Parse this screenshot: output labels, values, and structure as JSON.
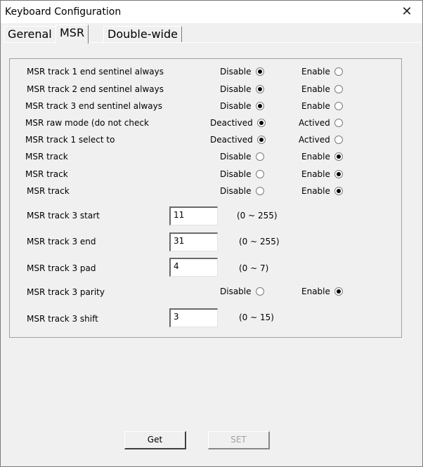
{
  "window": {
    "title": "Keyboard Configuration",
    "close_glyph": "✕"
  },
  "tabs": [
    {
      "label": "Gerenal",
      "active": false
    },
    {
      "label": "MSR",
      "active": true
    },
    {
      "label": "Double-wide",
      "active": false
    }
  ],
  "radio_rows": [
    {
      "label": "MSR track 1 end sentinel always",
      "opt1": "Disable",
      "opt2": "Enable",
      "selected": 1
    },
    {
      "label": "MSR track 2 end sentinel always",
      "opt1": "Disable",
      "opt2": "Enable",
      "selected": 1
    },
    {
      "label": "MSR track 3 end sentinel always",
      "opt1": "Disable",
      "opt2": "Enable",
      "selected": 1
    },
    {
      "label": "MSR raw mode (do not check",
      "opt1": "Deactived",
      "opt2": "Actived",
      "selected": 1
    },
    {
      "label": "MSR track 1 select to",
      "opt1": "Deactived",
      "opt2": "Actived",
      "selected": 1
    },
    {
      "label": "MSR track",
      "opt1": "Disable",
      "opt2": "Enable",
      "selected": 2
    },
    {
      "label": "MSR track",
      "opt1": "Disable",
      "opt2": "Enable",
      "selected": 2
    },
    {
      "label": "MSR track",
      "opt1": "Disable",
      "opt2": "Enable",
      "selected": 2
    }
  ],
  "fields": {
    "start": {
      "label": "MSR track 3 start",
      "value": "11",
      "range": "(0 ~ 255)"
    },
    "end": {
      "label": "MSR track 3 end",
      "value": "31",
      "range": "(0 ~ 255)"
    },
    "pad": {
      "label": "MSR track 3 pad",
      "value": "4",
      "range": "(0 ~ 7)"
    },
    "parity": {
      "label": "MSR track 3 parity",
      "opt1": "Disable",
      "opt2": "Enable",
      "selected": 2
    },
    "shift": {
      "label": "MSR track 3 shift",
      "value": "3",
      "range": "(0 ~ 15)"
    }
  },
  "buttons": {
    "get": "Get",
    "set": "SET",
    "set_enabled": false
  }
}
